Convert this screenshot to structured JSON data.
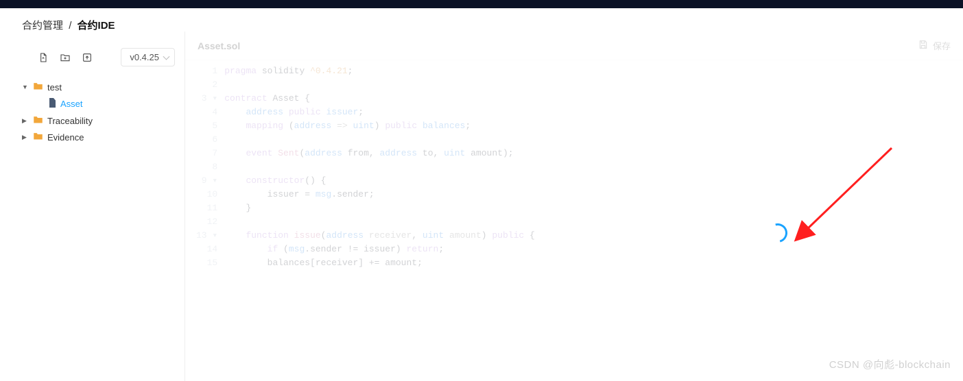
{
  "breadcrumb": {
    "parent": "合约管理",
    "sep": "/",
    "current": "合约IDE"
  },
  "toolbar": {
    "version": "v0.4.25"
  },
  "tree": {
    "root": {
      "label": "test"
    },
    "file1": {
      "label": "Asset"
    },
    "folder1": {
      "label": "Traceability"
    },
    "folder2": {
      "label": "Evidence"
    }
  },
  "editor": {
    "tab": "Asset.sol",
    "saveLabel": "保存"
  },
  "gutter": {
    "l1": "1",
    "l2": "2",
    "l3": "3 ▾",
    "l4": "4",
    "l5": "5",
    "l6": "6",
    "l7": "7",
    "l8": "8",
    "l9": "9 ▾",
    "l10": "10",
    "l11": "11",
    "l12": "12",
    "l13": "13 ▾",
    "l14": "14",
    "l15": "15"
  },
  "code": {
    "l1": {
      "a": "pragma",
      "b": " solidity ",
      "c": "^0.4.21",
      "d": ";"
    },
    "l2": "",
    "l3": {
      "a": "contract",
      "b": " Asset {"
    },
    "l4": {
      "a": "    address",
      "b": " public",
      "c": " issuer",
      "d": ";"
    },
    "l5": {
      "a": "    mapping",
      "b": " (",
      "c": "address",
      "d": " => ",
      "e": "uint",
      "f": ") ",
      "g": "public",
      "h": " balances",
      "i": ";"
    },
    "l6": "",
    "l7": {
      "a": "    event",
      "b": " Sent",
      "c": "(",
      "d": "address",
      "e": " from, ",
      "f": "address",
      "g": " to, ",
      "h": "uint",
      "i": " amount);"
    },
    "l8": "",
    "l9": {
      "a": "    constructor",
      "b": "() {"
    },
    "l10": {
      "a": "        issuer = ",
      "b": "msg",
      "c": ".sender;"
    },
    "l11": "    }",
    "l12": "",
    "l13": {
      "a": "    function",
      "b": " issue",
      "c": "(",
      "d": "address",
      "e": " receiver",
      "f": ", ",
      "g": "uint",
      "h": " amount",
      "i": ") ",
      "j": "public",
      "k": " {"
    },
    "l14": {
      "a": "        if",
      "b": " (",
      "c": "msg",
      "d": ".sender != issuer) ",
      "e": "return",
      "f": ";"
    },
    "l15": {
      "a": "        balances[receiver] += amount;"
    }
  },
  "watermark": "CSDN @向彪-blockchain"
}
